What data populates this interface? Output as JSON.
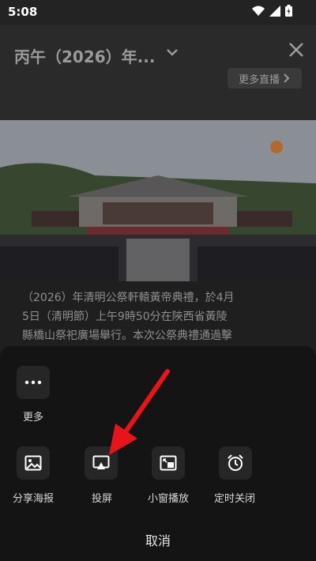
{
  "status_bar": {
    "time": "5:08"
  },
  "header": {
    "title": "丙午（2026）年...",
    "more_live_label": "更多直播"
  },
  "caption": {
    "lines": [
      "（2026）年清明公祭軒轅黃帝典禮，於4月",
      "5日（清明節）上午9時50分在陝西省黃陵",
      "縣橋山祭祀廣場舉行。本次公祭典禮通過擊"
    ]
  },
  "share_sheet": {
    "more_label": "更多",
    "items": [
      {
        "label": "分享海报",
        "icon": "image-icon"
      },
      {
        "label": "投屏",
        "icon": "cast-icon"
      },
      {
        "label": "小窗播放",
        "icon": "picture-in-picture-icon"
      },
      {
        "label": "定时关闭",
        "icon": "alarm-clock-icon"
      }
    ],
    "cancel_label": "取消"
  },
  "colors": {
    "annotation_arrow": "#e8141c"
  }
}
